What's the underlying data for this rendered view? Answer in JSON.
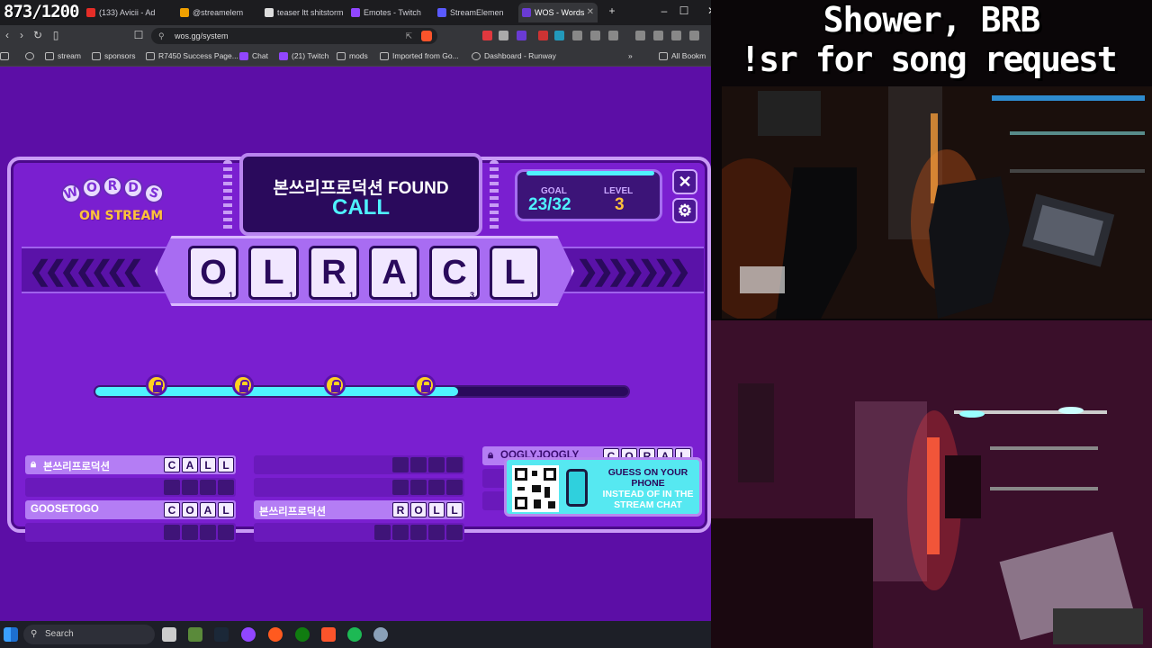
{
  "stream_counter": "873/1200",
  "browser": {
    "tabs": [
      {
        "label": "(133) Avicii - Ad",
        "color": "#e52d27"
      },
      {
        "label": "@streamelem",
        "color": "#f0a000"
      },
      {
        "label": "teaser ltt shitstorm",
        "color": "#dddddd"
      },
      {
        "label": "Emotes - Twitch",
        "color": "#9146ff"
      },
      {
        "label": "StreamElemen",
        "color": "#5a5aff"
      },
      {
        "label": "WOS - Words",
        "color": "#6a3bd4"
      }
    ],
    "active_tab_index": 5,
    "url": "wos.gg/system",
    "bookmarks": [
      "stream",
      "sponsors",
      "R7450 Success Page...",
      "Chat",
      "(21) Twitch",
      "mods",
      "Imported from Go...",
      "Dashboard - Runway"
    ],
    "all_bookmarks_label": "All Bookm",
    "window_controls": {
      "minimize": "–",
      "maximize": "☐",
      "close": "✕"
    }
  },
  "game": {
    "logo_letters": [
      "W",
      "O",
      "R",
      "D",
      "S"
    ],
    "logo_sub": "ON STREAM",
    "found_name": "본쓰리프로덕션 FOUND",
    "found_word": "CALL",
    "goal_label": "GOAL",
    "goal_value": "23/32",
    "level_label": "LEVEL",
    "level_value": "3",
    "close_label": "✕",
    "settings_label": "⚙",
    "tiles": [
      {
        "letter": "O",
        "points": "1"
      },
      {
        "letter": "L",
        "points": "1"
      },
      {
        "letter": "R",
        "points": "1"
      },
      {
        "letter": "A",
        "points": "1"
      },
      {
        "letter": "C",
        "points": "3"
      },
      {
        "letter": "L",
        "points": "1"
      }
    ],
    "progress_fraction": 0.68,
    "locks_count": 4,
    "words": {
      "w1_name": "본쓰리프로덕션",
      "w1_letters": [
        "C",
        "A",
        "L",
        "L"
      ],
      "w2_name": "GOOSETOGO",
      "w2_letters": [
        "C",
        "O",
        "A",
        "L"
      ],
      "w3_name": "본쓰리프로덕션",
      "w3_letters": [
        "R",
        "O",
        "L",
        "L"
      ],
      "w4_name": "OOGLYJOOGLY",
      "w4_letters": [
        "C",
        "O",
        "R",
        "A",
        "L"
      ]
    },
    "promo_line1": "GUESS ON YOUR PHONE",
    "promo_line2": "INSTEAD OF IN THE",
    "promo_line3": "STREAM CHAT"
  },
  "taskbar": {
    "search_placeholder": "Search"
  },
  "overlay": {
    "title_line1": "Shower, BRB",
    "title_line2": "!sr for song request"
  },
  "colors": {
    "accent_cyan": "#4ff2ff",
    "board_purple": "#7a1fd0",
    "page_purple": "#5c0ea6",
    "lock_yellow": "#ffd21f"
  }
}
